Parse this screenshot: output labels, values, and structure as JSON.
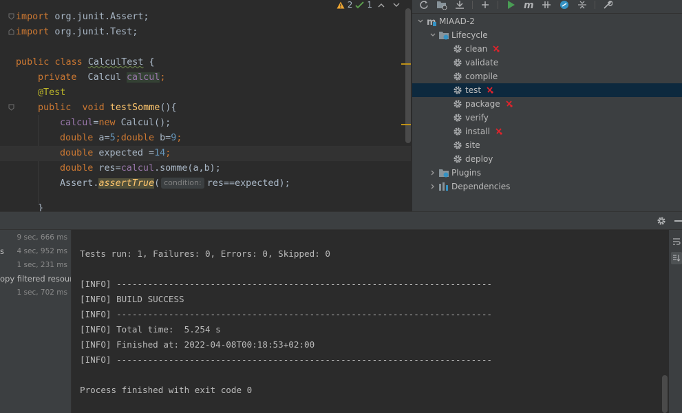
{
  "editor": {
    "inspections": {
      "warnings": "2",
      "weak_warnings": "1"
    },
    "lines": {
      "l1_kw": "import",
      "l1_rest": " org.junit.Assert;",
      "l2_kw": "import",
      "l2_rest": " org.junit.Test;",
      "l4_kw1": "public",
      "l4_kw2": "class",
      "l4_name": "CalculTest",
      "l4_rest": " {",
      "l5_kw": "private",
      "l5_type": "  Calcul ",
      "l5_field": "calcul",
      "l5_semi": ";",
      "l6_ann": "@Test",
      "l7_kw1": "public",
      "l7_kw2": "void",
      "l7_fn": "testSomme",
      "l7_rest": "(){",
      "l8_field": "calcul",
      "l8_eq": "=",
      "l8_kw": "new",
      "l8_rest": " Calcul();",
      "l9_kw1": "double",
      "l9_a": " a=",
      "l9_n1": "5",
      "l9_semi": ";",
      "l9_kw2": "double",
      "l9_b": " b=",
      "l9_n2": "9",
      "l9_end": ";",
      "l10_kw": "double",
      "l10_rest": " expected =",
      "l10_num": "14",
      "l10_end": ";",
      "l11_kw": "double",
      "l11_rest": " res=",
      "l11_field": "calcul",
      "l11_call": ".somme(a,b);",
      "l12_cls": "Assert.",
      "l12_fn": "assertTrue",
      "l12_open": "(",
      "l12_hint": "condition:",
      "l12_rest": "res==expected);",
      "l13": "}"
    }
  },
  "maven": {
    "project": "MIAAD-2",
    "lifecycle_label": "Lifecycle",
    "phases": [
      {
        "label": "clean",
        "breakpoint": true
      },
      {
        "label": "validate",
        "breakpoint": false
      },
      {
        "label": "compile",
        "breakpoint": false
      },
      {
        "label": "test",
        "breakpoint": true,
        "selected": true
      },
      {
        "label": "package",
        "breakpoint": true
      },
      {
        "label": "verify",
        "breakpoint": false
      },
      {
        "label": "install",
        "breakpoint": true
      },
      {
        "label": "site",
        "breakpoint": false
      },
      {
        "label": "deploy",
        "breakpoint": false
      }
    ],
    "plugins_label": "Plugins",
    "dependencies_label": "Dependencies"
  },
  "run": {
    "tree": [
      {
        "time": "9 sec, 666 ms",
        "label": ""
      },
      {
        "time": "4 sec, 952 ms",
        "label": "s"
      },
      {
        "time": "1 sec, 231 ms",
        "label": ""
      },
      {
        "time": "",
        "label": "opy filtered resourc"
      },
      {
        "time": "1 sec, 702 ms",
        "label": ""
      }
    ],
    "console": [
      "Tests run: 1, Failures: 0, Errors: 0, Skipped: 0",
      "",
      "[INFO] ------------------------------------------------------------------------",
      "[INFO] BUILD SUCCESS",
      "[INFO] ------------------------------------------------------------------------",
      "[INFO] Total time:  5.254 s",
      "[INFO] Finished at: 2022-04-08T00:18:53+02:00",
      "[INFO] ------------------------------------------------------------------------",
      "",
      "Process finished with exit code 0"
    ]
  },
  "colors": {
    "editor_bg": "#2b2b2b",
    "panel_bg": "#3c3f41",
    "selection": "#0d293e",
    "keyword": "#cc7832",
    "field": "#9876aa",
    "run_green": "#499c54",
    "breakpoint_red": "#e0242c"
  }
}
